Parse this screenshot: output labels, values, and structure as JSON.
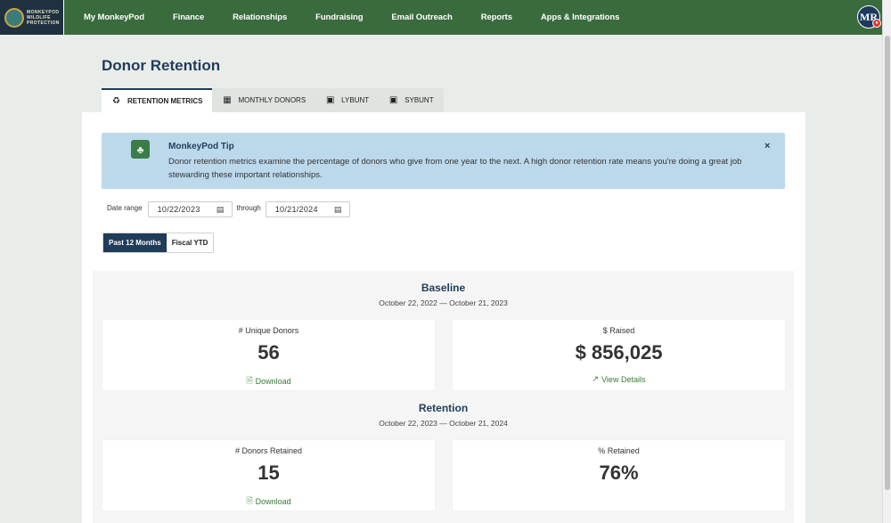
{
  "brand": {
    "logo_lines": [
      "MONKEYPOD",
      "WILDLIFE",
      "PROTECTION"
    ]
  },
  "nav": {
    "items": [
      "My MonkeyPod",
      "Finance",
      "Relationships",
      "Fundraising",
      "Email Outreach",
      "Reports",
      "Apps & Integrations"
    ],
    "avatar_initials": "MR"
  },
  "page": {
    "title": "Donor Retention"
  },
  "tabs": [
    {
      "label": "RETENTION METRICS",
      "icon": "recycle-icon",
      "active": true
    },
    {
      "label": "MONTHLY DONORS",
      "icon": "calendar-icon",
      "active": false
    },
    {
      "label": "LYBUNT",
      "icon": "calendar-clock-icon",
      "active": false
    },
    {
      "label": "SYBUNT",
      "icon": "calendar-clock-icon",
      "active": false
    }
  ],
  "tip": {
    "title": "MonkeyPod Tip",
    "text": "Donor retention metrics examine the percentage of donors who give from one year to the next. A high donor retention rate means you're doing a great job stewarding these important relationships.",
    "close": "×"
  },
  "filters": {
    "date_range_label": "Date range",
    "start_date": "10/22/2023",
    "through_label": "through",
    "end_date": "10/21/2024",
    "range_buttons": [
      "Past 12 Months",
      "Fiscal YTD"
    ],
    "active_range": "Past 12 Months"
  },
  "baseline": {
    "title": "Baseline",
    "period": "October 22, 2022 — October 21, 2023",
    "unique_donors": {
      "label": "# Unique Donors",
      "value": "56",
      "link": "Download"
    },
    "raised": {
      "label": "$ Raised",
      "value": "$ 856,025",
      "link": "View Details"
    }
  },
  "retention": {
    "title": "Retention",
    "period": "October 22, 2023 — October 21, 2024",
    "donors_retained": {
      "label": "# Donors Retained",
      "value": "15",
      "link": "Download"
    },
    "percent_retained": {
      "label": "% Retained",
      "value": "76%"
    }
  },
  "colors": {
    "nav_bg": "#3a6b3d",
    "primary": "#1f3c5a",
    "link": "#3a7a3c",
    "tip_bg": "#bcd9ec"
  }
}
